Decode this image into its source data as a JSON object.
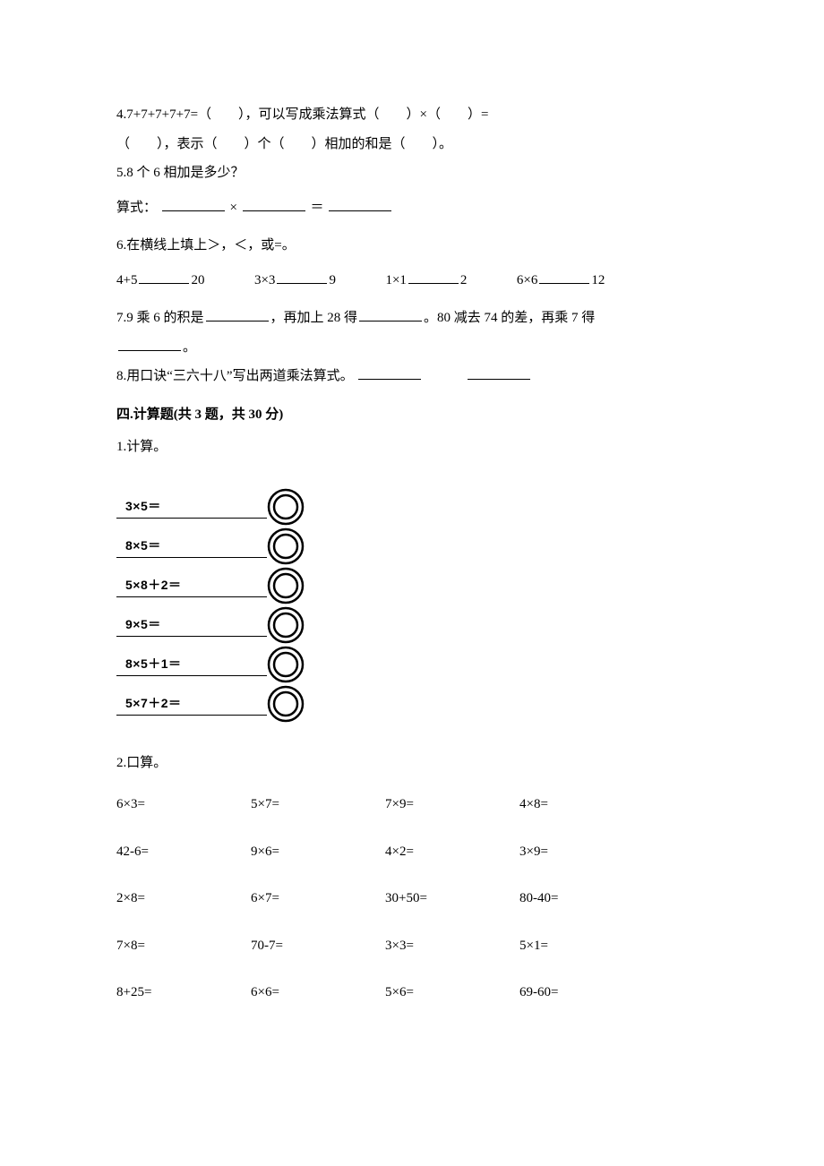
{
  "q4": {
    "text_a": "4.7+7+7+7+7=（　　），可以写成乘法算式（　　）×（　　）=",
    "text_b": "（　　），表示（　　）个（　　）相加的和是（　　）。"
  },
  "q5": {
    "text": "5.8 个 6 相加是多少？",
    "formula_prefix": "算式：",
    "times": "×",
    "eq": "＝"
  },
  "q6": {
    "text": "6.在横线上填上＞，＜，或=。",
    "items": [
      {
        "l": "4+5",
        "r": "20"
      },
      {
        "l": "3×3",
        "r": "9"
      },
      {
        "l": "1×1",
        "r": "2"
      },
      {
        "l": "6×6",
        "r": "12"
      }
    ]
  },
  "q7": {
    "a": "7.9 乘 6 的积是",
    "b": "，再加上 28 得",
    "c": "。80 减去 74 的差，再乘 7 得",
    "d": "。"
  },
  "q8": {
    "text": "8.用口诀“三六十八”写出两道乘法算式。"
  },
  "section4": {
    "title": "四.计算题(共 3 题，共 30 分)"
  },
  "p1": {
    "label": "1.计算。",
    "rows": [
      "3×5＝",
      "8×5＝",
      "5×8＋2＝",
      "9×5＝",
      "8×5＋1＝",
      "5×7＋2＝"
    ]
  },
  "p2": {
    "label": "2.口算。",
    "cells": [
      "6×3=",
      "5×7=",
      "7×9=",
      "4×8=",
      "42-6=",
      "9×6=",
      "4×2=",
      "3×9=",
      "2×8=",
      "6×7=",
      "30+50=",
      "80-40=",
      "7×8=",
      "70-7=",
      "3×3=",
      "5×1=",
      "8+25=",
      "6×6=",
      "5×6=",
      "69-60="
    ]
  }
}
